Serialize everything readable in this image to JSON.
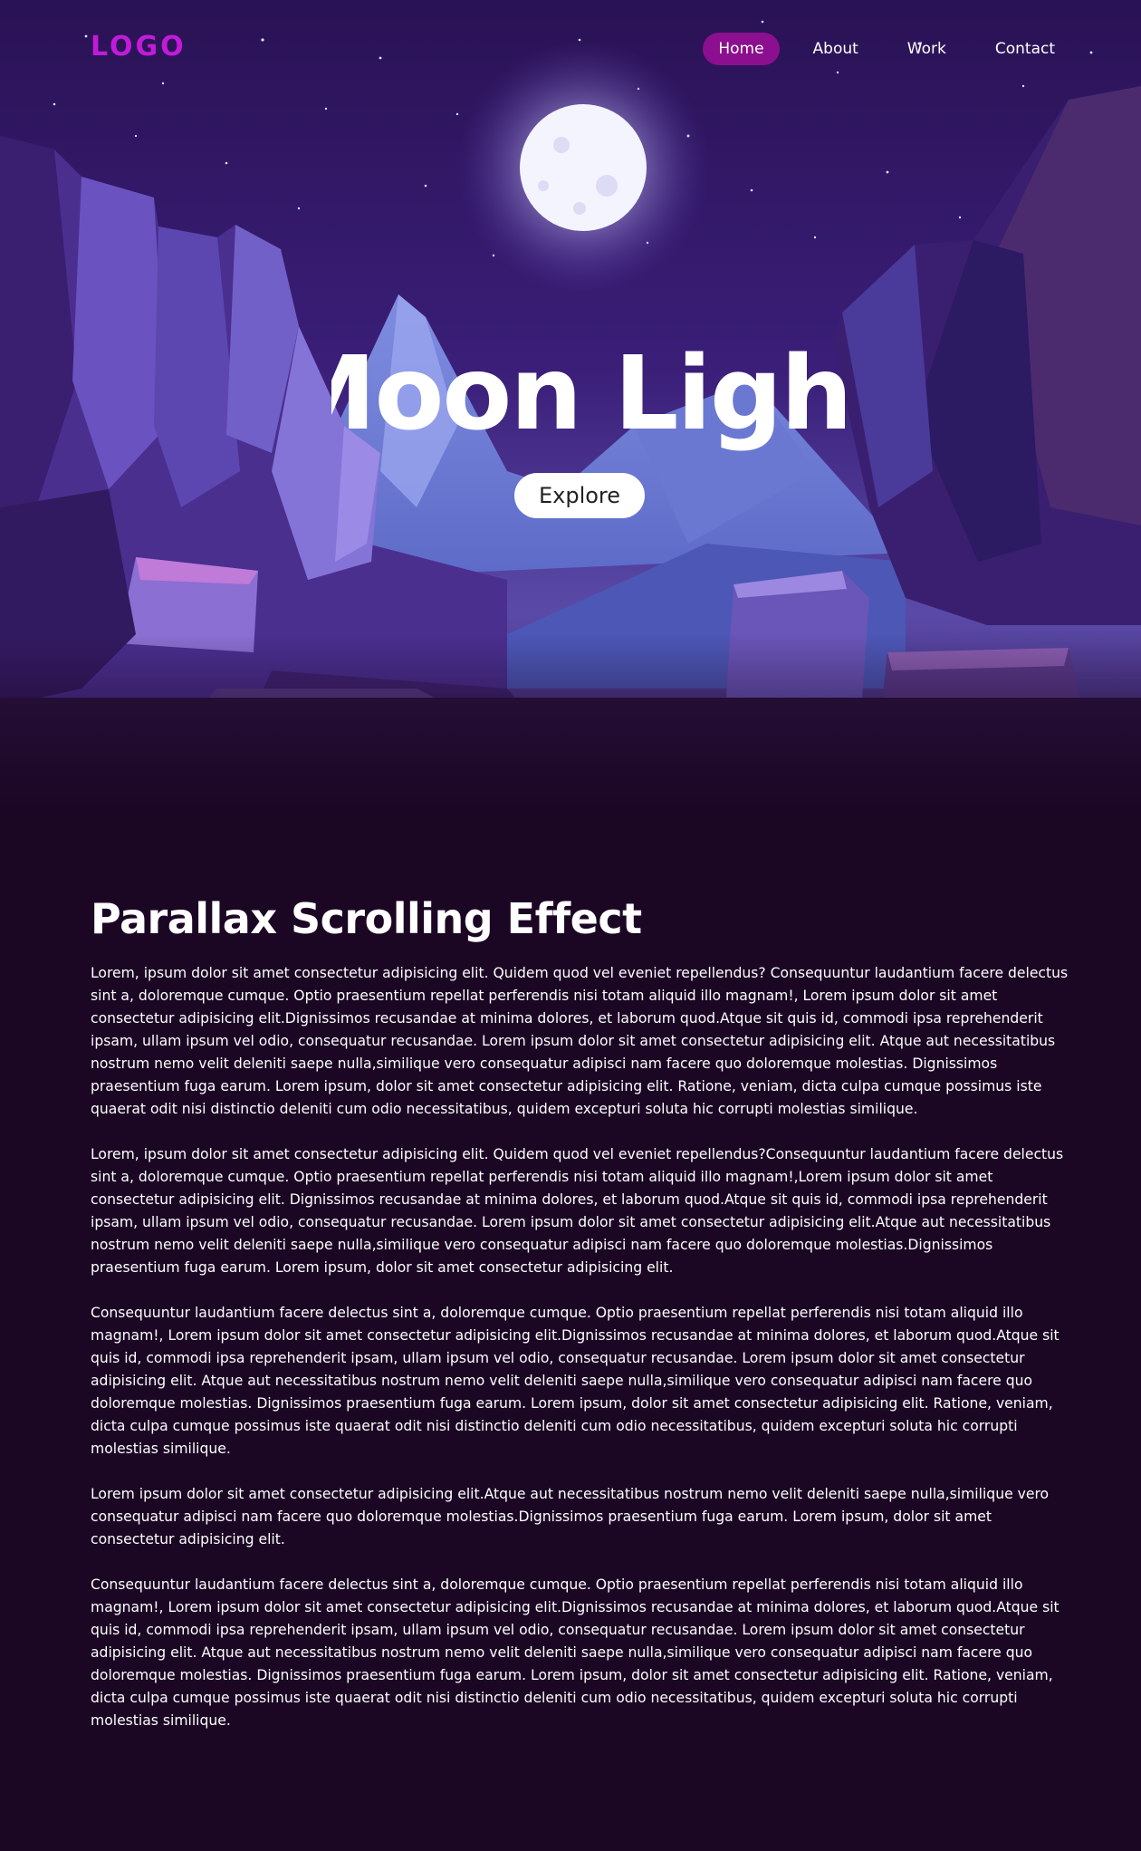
{
  "nav": {
    "logo": "LOGO",
    "links": [
      "Home",
      "About",
      "Work",
      "Contact"
    ],
    "active_link": "Home"
  },
  "hero": {
    "title": "Moon Light",
    "button_label": "Explore"
  },
  "main": {
    "heading": "Parallax Scrolling Effect",
    "paragraphs": [
      "Lorem, ipsum dolor sit amet consectetur adipisicing elit. Quidem quod vel eveniet repellendus? Consequuntur laudantium facere delectus sint a, doloremque cumque. Optio praesentium repellat perferendis nisi totam aliquid illo magnam!, Lorem ipsum dolor sit amet consectetur adipisicing elit.Dignissimos recusandae at minima dolores, et laborum quod.Atque sit quis id, commodi ipsa reprehenderit ipsam, ullam ipsum vel odio, consequatur recusandae. Lorem ipsum dolor sit amet consectetur adipisicing elit. Atque aut necessitatibus nostrum nemo velit deleniti saepe nulla,similique vero consequatur adipisci nam facere quo doloremque molestias. Dignissimos praesentium fuga earum. Lorem ipsum, dolor sit amet consectetur adipisicing elit. Ratione, veniam, dicta culpa cumque possimus iste quaerat odit nisi distinctio deleniti cum odio necessitatibus, quidem excepturi soluta hic corrupti molestias similique.",
      "Lorem, ipsum dolor sit amet consectetur adipisicing elit. Quidem quod vel eveniet repellendus?Consequuntur laudantium facere delectus sint a, doloremque cumque. Optio praesentium repellat perferendis nisi totam aliquid illo magnam!,Lorem ipsum dolor sit amet consectetur adipisicing elit. Dignissimos recusandae at minima dolores, et laborum quod.Atque sit quis id, commodi ipsa reprehenderit ipsam, ullam ipsum vel odio, consequatur recusandae. Lorem ipsum dolor sit amet consectetur adipisicing elit.Atque aut necessitatibus nostrum nemo velit deleniti saepe nulla,similique vero consequatur adipisci nam facere quo doloremque molestias.Dignissimos praesentium fuga earum. Lorem ipsum, dolor sit amet consectetur adipisicing elit.",
      "Consequuntur laudantium facere delectus sint a, doloremque cumque. Optio praesentium repellat perferendis nisi totam aliquid illo magnam!, Lorem ipsum dolor sit amet consectetur adipisicing elit.Dignissimos recusandae at minima dolores, et laborum quod.Atque sit quis id, commodi ipsa reprehenderit ipsam, ullam ipsum vel odio, consequatur recusandae. Lorem ipsum dolor sit amet consectetur adipisicing elit. Atque aut necessitatibus nostrum nemo velit deleniti saepe nulla,similique vero consequatur adipisci nam facere quo doloremque molestias. Dignissimos praesentium fuga earum. Lorem ipsum, dolor sit amet consectetur adipisicing elit. Ratione, veniam, dicta culpa cumque possimus iste quaerat odit nisi distinctio deleniti cum odio necessitatibus, quidem excepturi soluta hic corrupti molestias similique.",
      "Lorem ipsum dolor sit amet consectetur adipisicing elit.Atque aut necessitatibus nostrum nemo velit deleniti saepe nulla,similique vero consequatur adipisci nam facere quo doloremque molestias.Dignissimos praesentium fuga earum. Lorem ipsum, dolor sit amet consectetur adipisicing elit.",
      "Consequuntur laudantium facere delectus sint a, doloremque cumque. Optio praesentium repellat perferendis nisi totam aliquid illo magnam!, Lorem ipsum dolor sit amet consectetur adipisicing elit.Dignissimos recusandae at minima dolores, et laborum quod.Atque sit quis id, commodi ipsa reprehenderit ipsam, ullam ipsum vel odio, consequatur recusandae. Lorem ipsum dolor sit amet consectetur adipisicing elit. Atque aut necessitatibus nostrum nemo velit deleniti saepe nulla,similique vero consequatur adipisci nam facere quo doloremque molestias. Dignissimos praesentium fuga earum. Lorem ipsum, dolor sit amet consectetur adipisicing elit. Ratione, veniam, dicta culpa cumque possimus iste quaerat odit nisi distinctio deleniti cum odio necessitatibus, quidem excepturi soluta hic corrupti molestias similique."
    ]
  },
  "colors": {
    "background": "#1b0624",
    "logo": "#c21bd8",
    "nav_active": "#8c0f8f",
    "sky_top": "#2a1255",
    "moon": "#f4f4ff"
  },
  "icons": [
    "moon-illustration",
    "stars-illustration",
    "cliffs-illustration",
    "mountain-illustration"
  ]
}
